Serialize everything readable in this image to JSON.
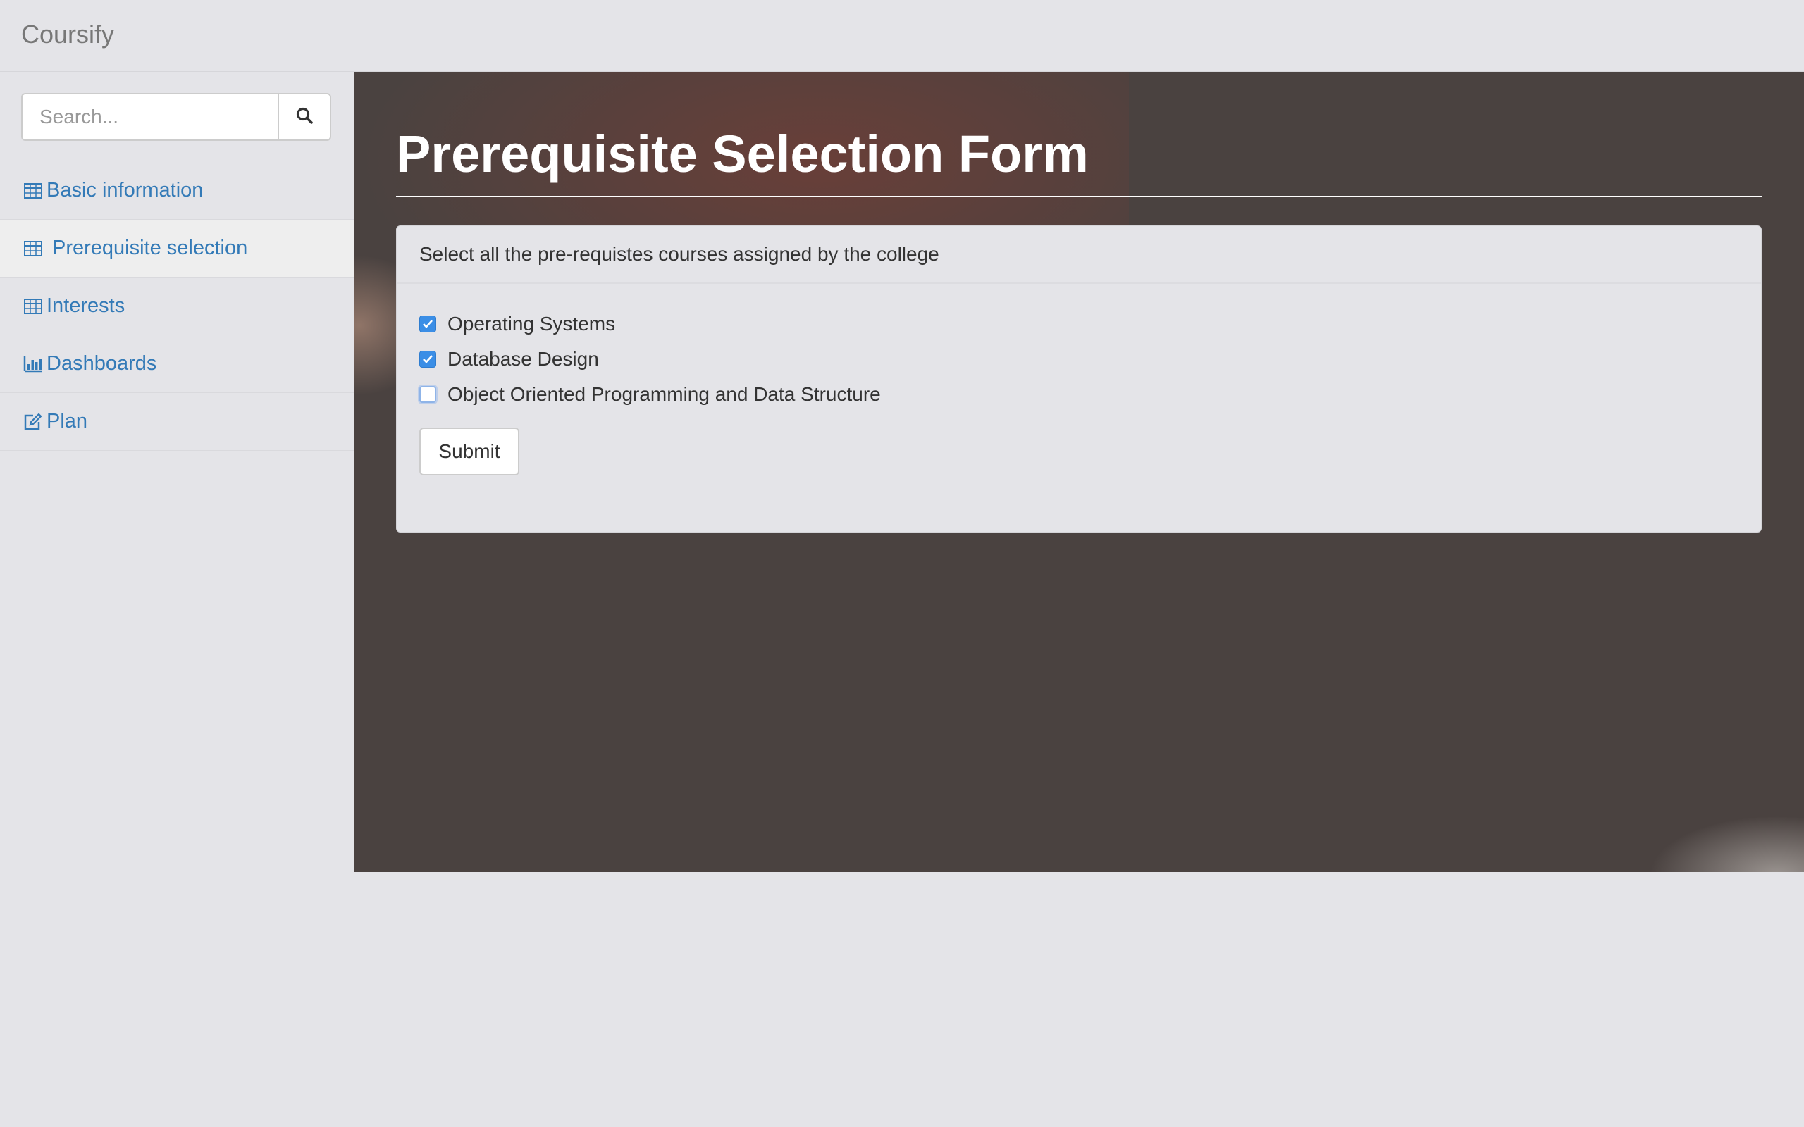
{
  "navbar": {
    "brand": "Coursify"
  },
  "sidebar": {
    "search": {
      "placeholder": "Search...",
      "value": ""
    },
    "items": [
      {
        "label": "Basic information",
        "icon": "table-icon",
        "active": false
      },
      {
        "label": "Prerequisite selection",
        "icon": "table-icon",
        "active": true
      },
      {
        "label": "Interests",
        "icon": "table-icon",
        "active": false
      },
      {
        "label": "Dashboards",
        "icon": "bar-chart-icon",
        "active": false
      },
      {
        "label": "Plan",
        "icon": "edit-icon",
        "active": false
      }
    ]
  },
  "main": {
    "title": "Prerequisite Selection Form",
    "panel": {
      "heading": "Select all the pre-requistes courses assigned by the college",
      "options": [
        {
          "label": "Operating Systems",
          "checked": true
        },
        {
          "label": "Database Design",
          "checked": true
        },
        {
          "label": "Object Oriented Programming and Data Structure",
          "checked": false
        }
      ],
      "submit_label": "Submit"
    }
  },
  "colors": {
    "link": "#337ab7",
    "brand_text": "#777777",
    "checkbox_checked": "#3b8ee6",
    "main_background": "#4a4240",
    "page_background": "#e4e4e8"
  }
}
